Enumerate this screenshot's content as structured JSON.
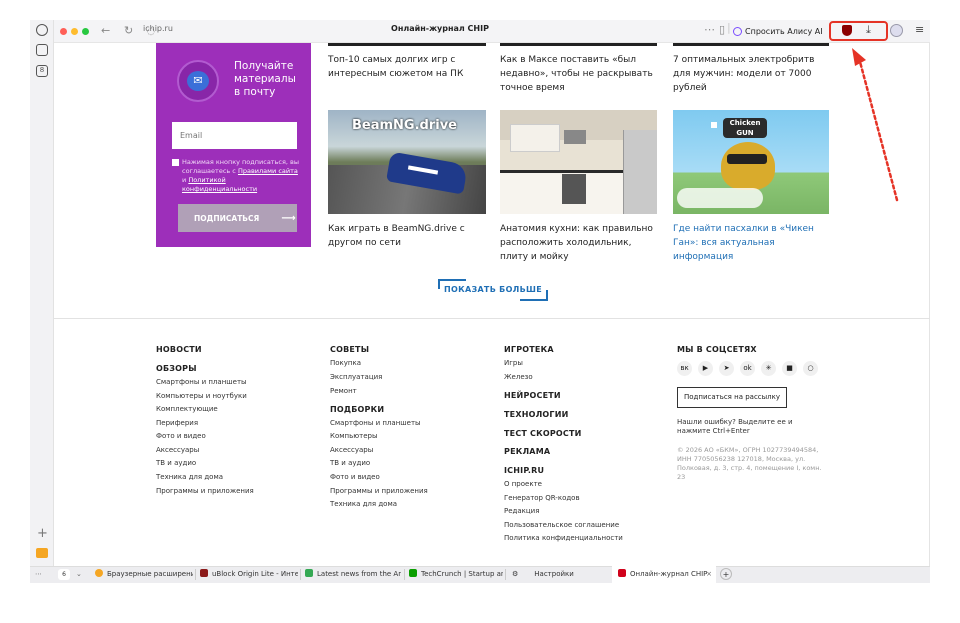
{
  "browser": {
    "address": "ichip.ru",
    "page_title": "Онлайн-журнал CHIP",
    "alice_label": "Спросить Алису AI",
    "sidebar_icon_3": "8"
  },
  "promo": {
    "title": "Получайте материалы в почту",
    "email_placeholder": "Email",
    "agree_text": "Нажимая кнопку подписаться, вы соглашаетесь с",
    "terms_link": "Правилами сайта",
    "and": "и",
    "privacy_link": "Политикой конфиденциальности",
    "subscribe_label": "ПОДПИСАТЬСЯ",
    "subscribe_arrow": "⟶"
  },
  "articles_top": [
    {
      "title": "Топ-10 самых долгих игр с интересным сюжетом на ПК"
    },
    {
      "title": "Как в Максе поставить «был недавно», чтобы не раскрывать точное время"
    },
    {
      "title": "7 оптимальных электробритв для мужчин: модели от 7000 рублей"
    }
  ],
  "articles": [
    {
      "title": "Как играть в BeamNG.drive с другом по сети",
      "thumb_text": "BeamNG.drive"
    },
    {
      "title": "Анатомия кухни: как правильно расположить холодильник, плиту и мойку"
    },
    {
      "title": "Где найти пасхалки в «Чикен Ган»: вся актуальная информация",
      "thumb_text": "Chicken GUN"
    }
  ],
  "show_more": "ПОКАЗАТЬ БОЛЬШЕ",
  "footer": {
    "col1": {
      "news": "НОВОСТИ",
      "reviews": "ОБЗОРЫ",
      "links": [
        "Смартфоны и планшеты",
        "Компьютеры и ноутбуки",
        "Комплектующие",
        "Периферия",
        "Фото и видео",
        "Аксессуары",
        "ТВ и аудио",
        "Техника для дома",
        "Программы и приложения"
      ]
    },
    "col2": {
      "tips": "СОВЕТЫ",
      "tips_links": [
        "Покупка",
        "Эксплуатация",
        "Ремонт"
      ],
      "picks": "ПОДБОРКИ",
      "picks_links": [
        "Смартфоны и планшеты",
        "Компьютеры",
        "Аксессуары",
        "ТВ и аудио",
        "Фото и видео",
        "Программы и приложения",
        "Техника для дома"
      ]
    },
    "col3": {
      "games": "ИГРОТЕКА",
      "games_links": [
        "Игры",
        "Железо"
      ],
      "ai": "НЕЙРОСЕТИ",
      "tech": "ТЕХНОЛОГИИ",
      "speed": "ТЕСТ СКОРОСТИ",
      "ads": "РЕКЛАМА",
      "ichip": "ICHIP.RU",
      "ichip_links": [
        "О проекте",
        "Генератор QR-кодов",
        "Редакция",
        "Пользовательское соглашение",
        "Политика конфиденциальности"
      ]
    },
    "col4": {
      "social": "МЫ В СОЦСЕТЯХ",
      "social_icons": [
        "vk",
        "youtube",
        "telegram",
        "ok",
        "dzen",
        "rutube",
        "max"
      ],
      "newsletter": "Подписаться на рассылку",
      "error_note": "Нашли ошибку? Выделите ее и нажмите Ctrl+Enter",
      "legal": "© 2026 АО «БКМ», ОГРН 1027739494584, ИНН 7705056238 127018, Москва, ул. Полковая, д. 3, стр. 4, помещение I, комн. 23"
    }
  },
  "tabs": {
    "count": "6",
    "items": [
      {
        "label": "Браузерные расширения",
        "color": "#f5a623"
      },
      {
        "label": "uBlock Origin Lite - Интер",
        "color": "#8b1a1a"
      },
      {
        "label": "Latest news from the Andr",
        "color": "#34a853"
      },
      {
        "label": "TechCrunch | Startup and",
        "color": "#0a9e01"
      },
      {
        "label": "Настройки",
        "color": "#444"
      },
      {
        "label": "Онлайн-журнал CHIP",
        "color": "#d0021b"
      }
    ]
  },
  "colors": {
    "promo": "#9d2fba",
    "accent": "#1f6fb5",
    "annotation": "#e53326"
  }
}
